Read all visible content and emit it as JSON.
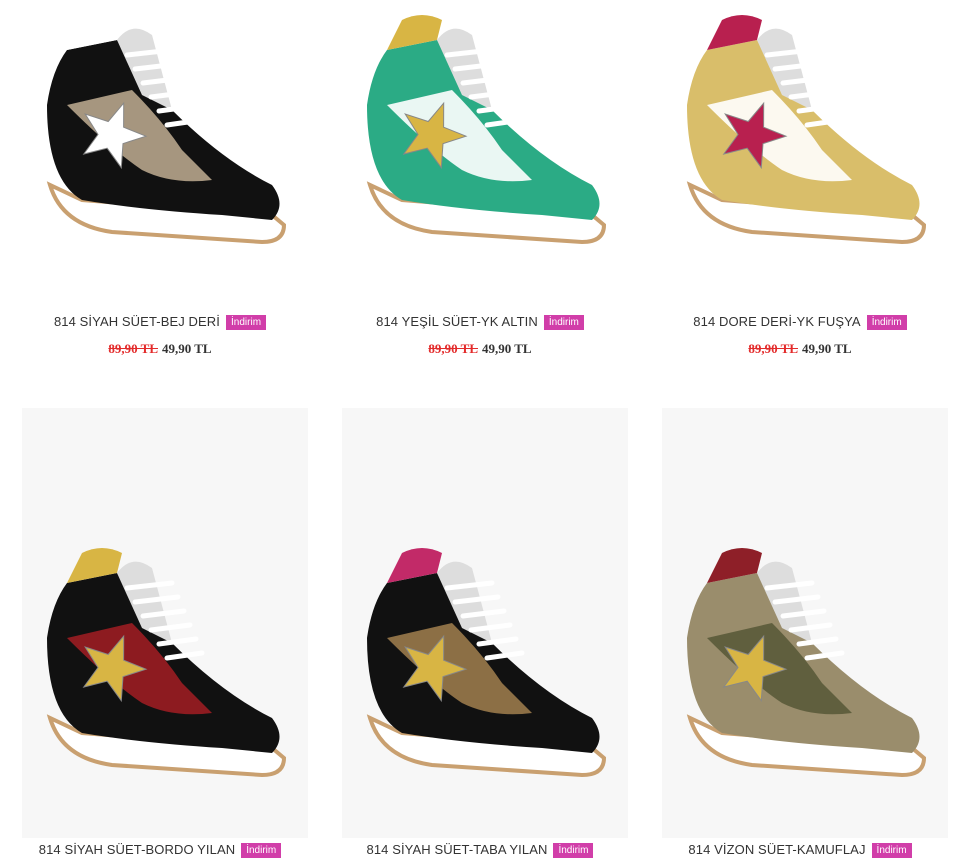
{
  "products": [
    {
      "name": "814 SİYAH SÜET-BEJ DERİ",
      "badge": "İndirim",
      "old_price": "89,90 TL",
      "new_price": "49,90 TL",
      "colors": {
        "body": "#111111",
        "accent": "#b7a58c",
        "star": "#ffffff",
        "collar": "#ffffff",
        "sole": "#ffffff"
      }
    },
    {
      "name": "814 YEŞİL SÜET-YK ALTIN",
      "badge": "İndirim",
      "old_price": "89,90 TL",
      "new_price": "49,90 TL",
      "colors": {
        "body": "#2bab85",
        "accent": "#ffffff",
        "star": "#d8b544",
        "collar": "#d8b544",
        "sole": "#ffffff"
      }
    },
    {
      "name": "814 DORE DERİ-YK FUŞYA",
      "badge": "İndirim",
      "old_price": "89,90 TL",
      "new_price": "49,90 TL",
      "colors": {
        "body": "#d9be6a",
        "accent": "#ffffff",
        "star": "#b8204f",
        "collar": "#b8204f",
        "sole": "#ffffff"
      }
    },
    {
      "name": "814 SİYAH SÜET-BORDO YILAN",
      "badge": "İndirim",
      "colors": {
        "body": "#111111",
        "accent": "#9b1d22",
        "star": "#d8b544",
        "collar": "#d8b544",
        "sole": "#ffffff"
      }
    },
    {
      "name": "814 SİYAH SÜET-TABA YILAN",
      "badge": "İndirim",
      "colors": {
        "body": "#111111",
        "accent": "#9a7a4b",
        "star": "#d8b544",
        "collar": "#c22a68",
        "sole": "#ffffff"
      }
    },
    {
      "name": "814 VİZON SÜET-KAMUFLAJ",
      "badge": "İndirim",
      "colors": {
        "body": "#9a8d6c",
        "accent": "#5a5a3a",
        "star": "#d8b544",
        "collar": "#8e1f28",
        "sole": "#ffffff"
      }
    }
  ]
}
